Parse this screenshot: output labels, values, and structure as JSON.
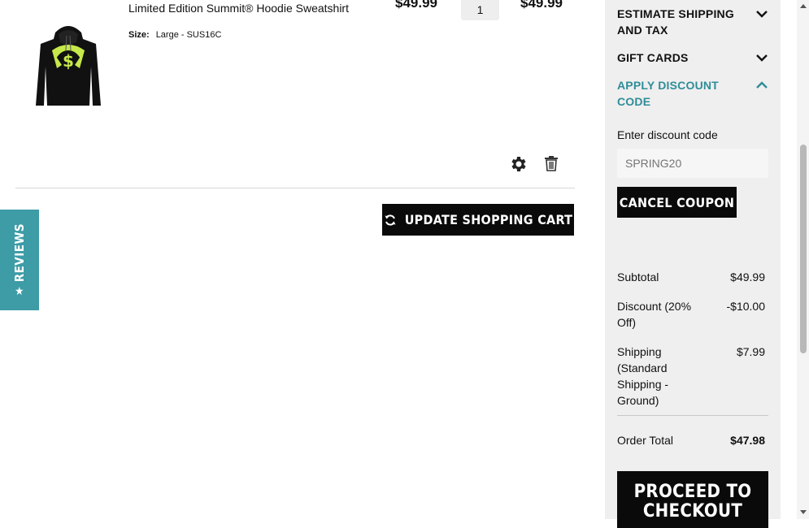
{
  "cart": {
    "item": {
      "name": "Limited Edition Summit® Hoodie Sweatshirt",
      "option_label": "Size:",
      "option_value": "Large - SUS16C",
      "price": "$49.99",
      "qty": "1",
      "subtotal": "$49.99",
      "image_icon": "hoodie-image"
    },
    "update_label": "UPDATE SHOPPING CART"
  },
  "reviews_tab": {
    "label": "REVIEWS",
    "icon": "★"
  },
  "sidebar": {
    "accordion": [
      {
        "label_line1": "ESTIMATE SHIPPING",
        "label_line2": "AND TAX",
        "state": "collapsed"
      },
      {
        "label_line1": "GIFT CARDS",
        "label_line2": "",
        "state": "collapsed"
      },
      {
        "label_line1": "APPLY DISCOUNT",
        "label_line2": "CODE",
        "state": "expanded"
      }
    ],
    "discount": {
      "field_label": "Enter discount code",
      "placeholder": "SPRING20",
      "cancel_label": "CANCEL COUPON"
    },
    "summary": {
      "subtotal_label": "Subtotal",
      "subtotal_value": "$49.99",
      "discount_label_1": "Discount (20%",
      "discount_label_2": "Off)",
      "discount_value": "-$10.00",
      "shipping_label_1": "Shipping",
      "shipping_label_2": "(Standard",
      "shipping_label_3": "Shipping -",
      "shipping_label_4": "Ground)",
      "shipping_value": "$7.99",
      "total_label": "Order Total",
      "total_value": "$47.98"
    },
    "checkout_line1": "PROCEED TO",
    "checkout_line2": "CHECKOUT"
  },
  "colors": {
    "accent": "#2f8d98",
    "reviews_tab": "#3d9ca6",
    "button": "#0a0a0a",
    "sidebar_bg": "#efefef",
    "hoodie_print": "#c6e84a"
  }
}
